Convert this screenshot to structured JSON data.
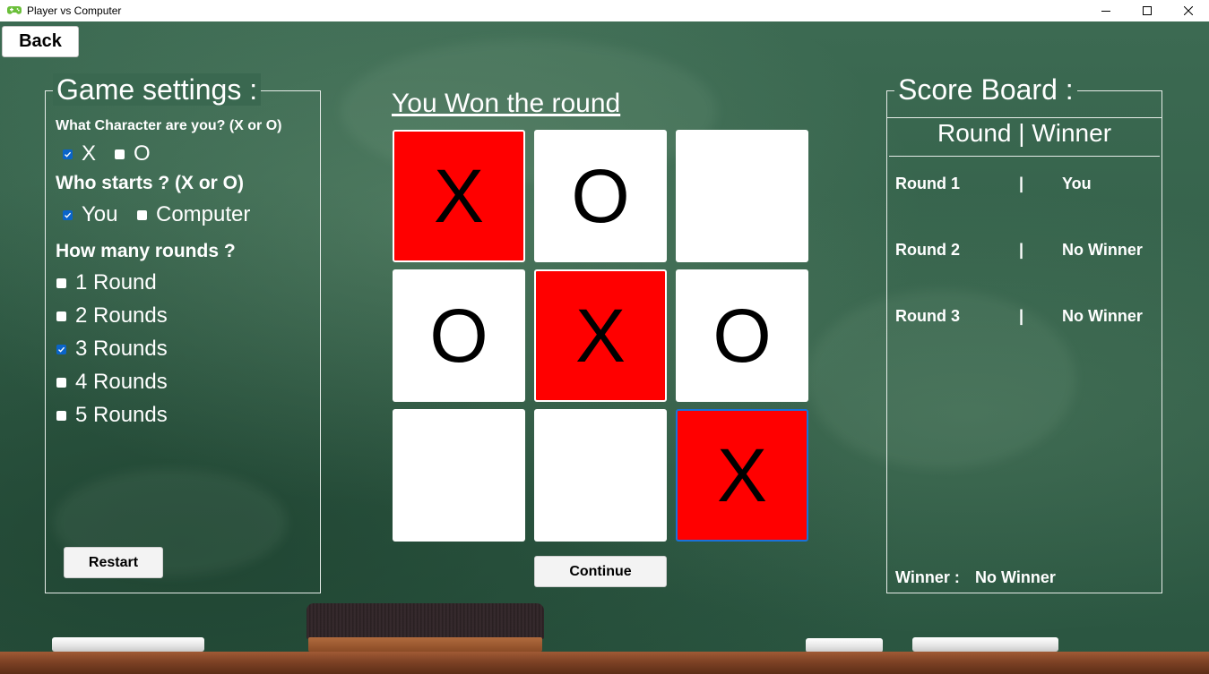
{
  "window": {
    "title": "Player vs Computer"
  },
  "back_button": "Back",
  "settings": {
    "legend": "Game settings :",
    "character_question": "What Character are you? (X or O)",
    "character_options": [
      {
        "label": "X",
        "checked": true
      },
      {
        "label": "O",
        "checked": false
      }
    ],
    "starter_question": "Who starts ? (X or O)",
    "starter_options": [
      {
        "label": "You",
        "checked": true
      },
      {
        "label": "Computer",
        "checked": false
      }
    ],
    "rounds_question": "How many rounds ?",
    "rounds_options": [
      {
        "label": "1 Round",
        "checked": false
      },
      {
        "label": "2 Rounds",
        "checked": false
      },
      {
        "label": "3 Rounds",
        "checked": true
      },
      {
        "label": "4 Rounds",
        "checked": false
      },
      {
        "label": "5 Rounds",
        "checked": false
      }
    ],
    "restart_button": "Restart"
  },
  "game": {
    "status": "You Won the round",
    "board": [
      {
        "mark": "X",
        "winning": true
      },
      {
        "mark": "O",
        "winning": false
      },
      {
        "mark": "",
        "winning": false
      },
      {
        "mark": "O",
        "winning": false
      },
      {
        "mark": "X",
        "winning": true
      },
      {
        "mark": "O",
        "winning": false
      },
      {
        "mark": "",
        "winning": false
      },
      {
        "mark": "",
        "winning": false
      },
      {
        "mark": "X",
        "winning": true
      }
    ],
    "continue_button": "Continue",
    "colors": {
      "winning_cell": "#ff0000",
      "cell": "#ffffff"
    }
  },
  "scoreboard": {
    "legend": "Score Board :",
    "header": "Round | Winner",
    "separator": "|",
    "rows": [
      {
        "round": "Round 1",
        "winner": "You"
      },
      {
        "round": "Round 2",
        "winner": "No Winner"
      },
      {
        "round": "Round 3",
        "winner": "No Winner"
      }
    ],
    "winner_label": "Winner :",
    "winner_value": "No Winner"
  }
}
